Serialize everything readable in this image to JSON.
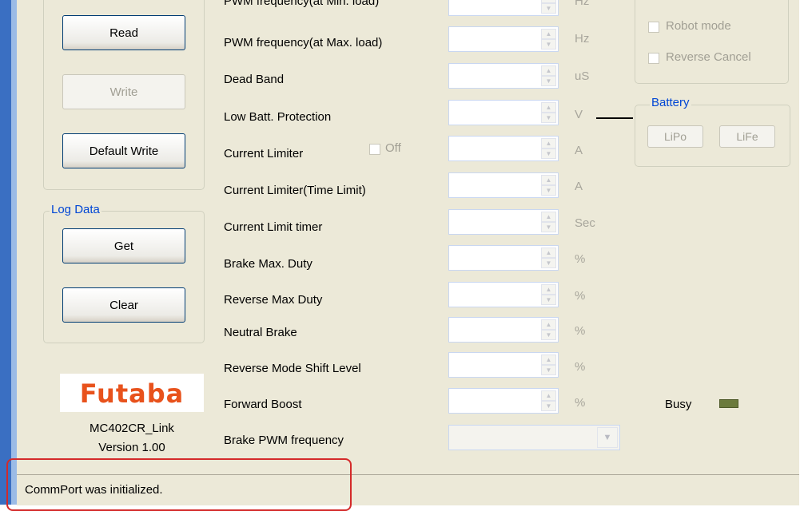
{
  "buttons": {
    "read": "Read",
    "write": "Write",
    "default_write": "Default Write"
  },
  "log_data": {
    "legend": "Log Data",
    "get": "Get",
    "clear": "Clear"
  },
  "params": [
    {
      "label": "PWM frequency(at Min. load)",
      "unit": "Hz"
    },
    {
      "label": "PWM frequency(at Max. load)",
      "unit": "Hz"
    },
    {
      "label": "Dead Band",
      "unit": "uS"
    },
    {
      "label": "Low Batt. Protection",
      "unit": "V"
    },
    {
      "label": "Current Limiter",
      "unit": "A",
      "checkbox_label": "Off"
    },
    {
      "label": "Current Limiter(Time Limit)",
      "unit": "A"
    },
    {
      "label": "Current Limit timer",
      "unit": "Sec"
    },
    {
      "label": "Brake Max. Duty",
      "unit": "%"
    },
    {
      "label": "Reverse Max Duty",
      "unit": "%"
    },
    {
      "label": "Neutral Brake",
      "unit": "%"
    },
    {
      "label": "Reverse Mode Shift Level",
      "unit": "%"
    },
    {
      "label": "Forward Boost",
      "unit": "%"
    },
    {
      "label": "Brake PWM frequency"
    }
  ],
  "options": {
    "robot_mode": "Robot mode",
    "reverse_cancel": "Reverse Cancel"
  },
  "battery": {
    "legend": "Battery",
    "lipo": "LiPo",
    "life": "LiFe"
  },
  "busy_label": "Busy",
  "colors": {
    "busy_led": "#6b7a3c",
    "highlight": "#d42a2a"
  },
  "logo_text": "Futaba",
  "app_name": "MC402CR_Link",
  "version": "Version 1.00",
  "status": "CommPort was initialized."
}
